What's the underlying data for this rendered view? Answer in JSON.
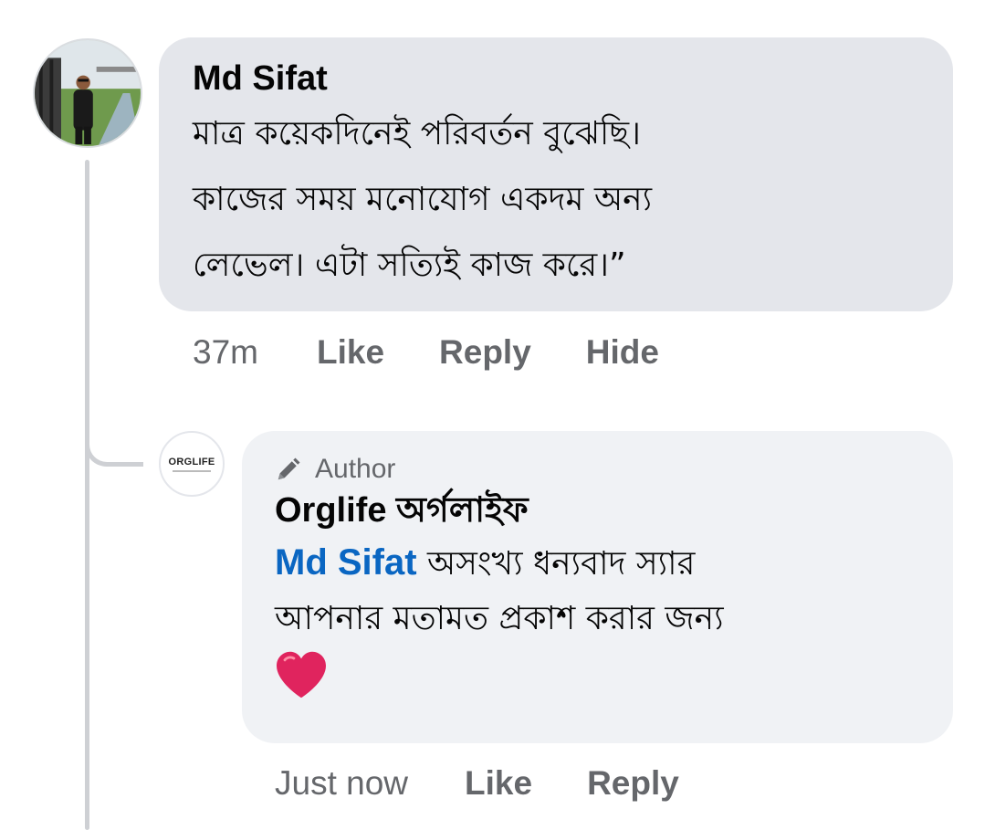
{
  "comment": {
    "author": "Md Sifat",
    "lines": [
      "মাত্র কয়েকদিনেই পরিবর্তন বুঝেছি।",
      "কাজের সময় মনোযোগ একদম অন্য",
      "লেভেল। এটা সত্যিই কাজ করে।”"
    ],
    "time": "37m",
    "actions": {
      "like": "Like",
      "reply": "Reply",
      "hide": "Hide"
    },
    "avatar_icon": "user-photo-avatar"
  },
  "reply": {
    "badge": "Author",
    "badge_icon": "pencil-icon",
    "author": "Orglife অর্গলাইফ",
    "logo_text": "ORGLIFE",
    "mention": "Md Sifat",
    "line1_rest": " অসংখ্য ধন্যবাদ স্যার",
    "line2": "আপনার মতামত প্রকাশ করার জন্য",
    "emoji_icon": "red-heart-icon",
    "time": "Just now",
    "actions": {
      "like": "Like",
      "reply": "Reply"
    }
  },
  "colors": {
    "main_bubble": "#e4e6eb",
    "reply_bubble": "#f0f2f5",
    "mention": "#0a66c2",
    "meta_text": "#65676b",
    "thread_line": "#ced0d4",
    "heart": "#e0245e"
  }
}
